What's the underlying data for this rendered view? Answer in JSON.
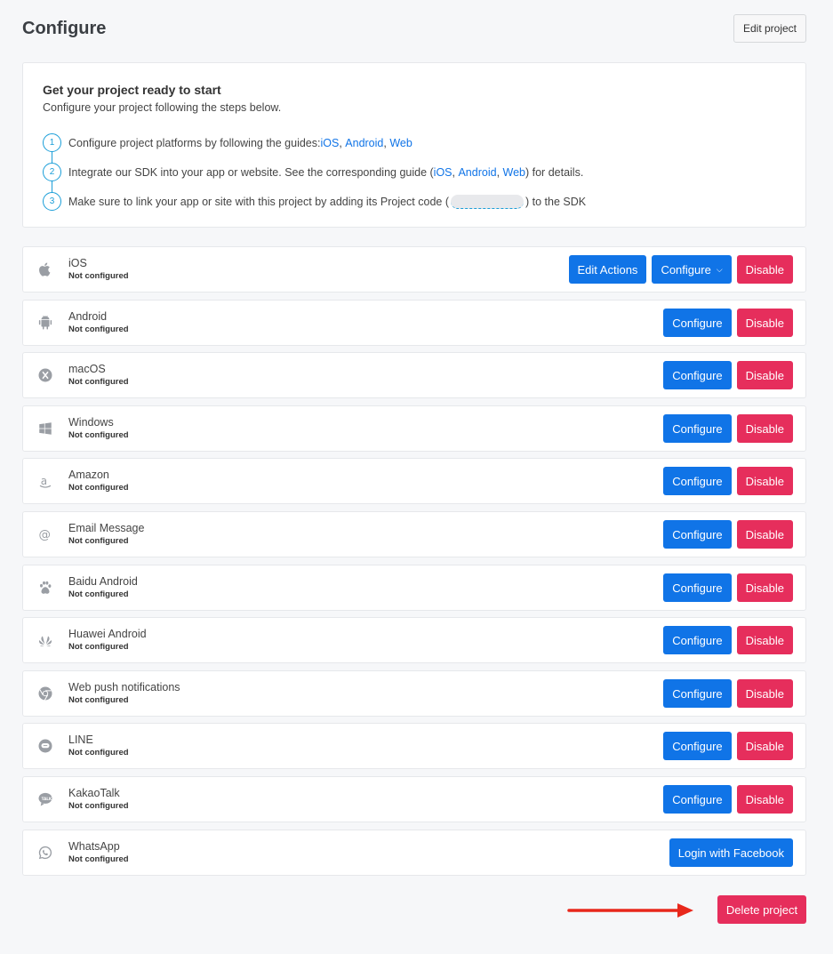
{
  "header": {
    "title": "Configure",
    "edit_project_label": "Edit project"
  },
  "steps": {
    "title": "Get your project ready to start",
    "subtitle": "Configure your project following the steps below.",
    "items": [
      {
        "num": "1",
        "text": "Configure project platforms by following the guides: ",
        "links": [
          "iOS",
          "Android",
          "Web"
        ]
      },
      {
        "num": "2",
        "text_before": "Integrate our SDK into your app or website. See the corresponding guide (",
        "links": [
          "iOS",
          "Android",
          "Web"
        ],
        "text_after": ") for details."
      },
      {
        "num": "3",
        "text_before": "Make sure to link your app or site with this project by adding its Project code (",
        "text_after": ") to the SDK"
      }
    ]
  },
  "platforms": [
    {
      "name": "iOS",
      "status": "Not configured",
      "icon": "apple-icon",
      "edit_actions": "Edit Actions",
      "configure": "Configure",
      "disable": "Disable"
    },
    {
      "name": "Android",
      "status": "Not configured",
      "icon": "android-icon",
      "configure": "Configure",
      "disable": "Disable"
    },
    {
      "name": "macOS",
      "status": "Not configured",
      "icon": "macos-icon",
      "configure": "Configure",
      "disable": "Disable"
    },
    {
      "name": "Windows",
      "status": "Not configured",
      "icon": "windows-icon",
      "configure": "Configure",
      "disable": "Disable"
    },
    {
      "name": "Amazon",
      "status": "Not configured",
      "icon": "amazon-icon",
      "configure": "Configure",
      "disable": "Disable"
    },
    {
      "name": "Email Message",
      "status": "Not configured",
      "icon": "at-sign-icon",
      "configure": "Configure",
      "disable": "Disable"
    },
    {
      "name": "Baidu Android",
      "status": "Not configured",
      "icon": "baidu-icon",
      "configure": "Configure",
      "disable": "Disable"
    },
    {
      "name": "Huawei Android",
      "status": "Not configured",
      "icon": "huawei-icon",
      "configure": "Configure",
      "disable": "Disable"
    },
    {
      "name": "Web push notifications",
      "status": "Not configured",
      "icon": "chrome-icon",
      "configure": "Configure",
      "disable": "Disable"
    },
    {
      "name": "LINE",
      "status": "Not configured",
      "icon": "line-icon",
      "configure": "Configure",
      "disable": "Disable"
    },
    {
      "name": "KakaoTalk",
      "status": "Not configured",
      "icon": "kakaotalk-icon",
      "configure": "Configure",
      "disable": "Disable"
    },
    {
      "name": "WhatsApp",
      "status": "Not configured",
      "icon": "whatsapp-icon",
      "login": "Login with Facebook"
    }
  ],
  "footer": {
    "delete_label": "Delete project"
  },
  "colors": {
    "primary": "#1074e7",
    "danger": "#e62e5c",
    "step_accent": "#1a9ed8",
    "arrow": "#e8281c"
  }
}
